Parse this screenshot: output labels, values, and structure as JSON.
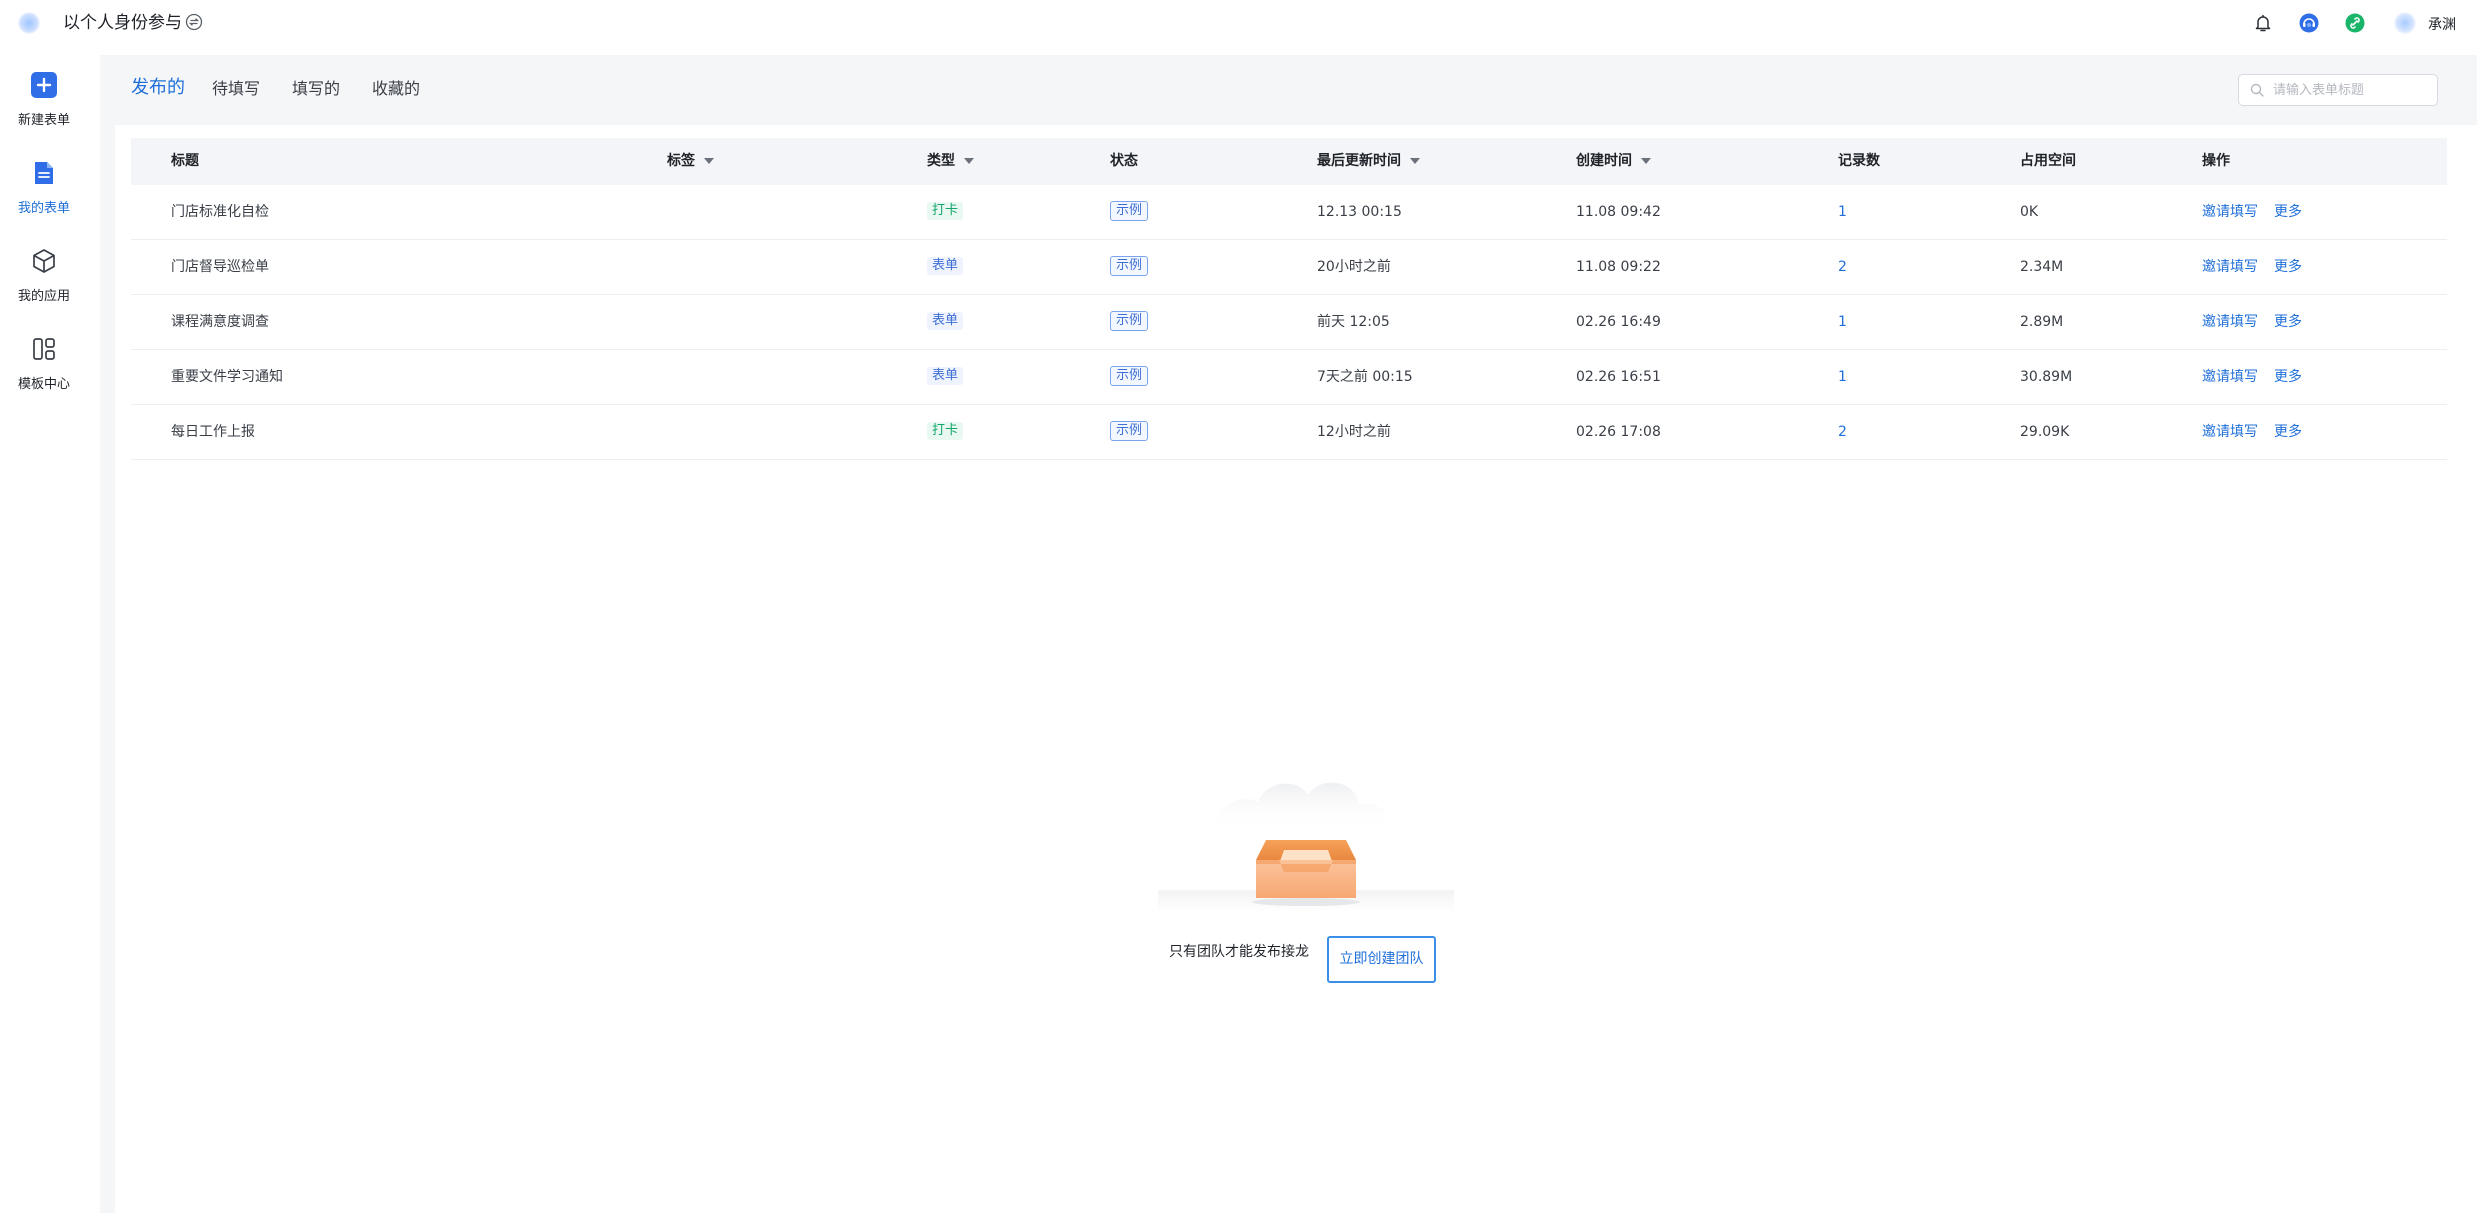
{
  "topbar": {
    "workspace_title": "以个人身份参与",
    "username": "承渊"
  },
  "sidenav": {
    "items": [
      {
        "label": "新建表单",
        "icon": "plus-square-icon"
      },
      {
        "label": "我的表单",
        "icon": "document-icon",
        "active": true
      },
      {
        "label": "我的应用",
        "icon": "cube-icon"
      },
      {
        "label": "模板中心",
        "icon": "layout-icon"
      }
    ]
  },
  "tabs": [
    {
      "label": "发布的",
      "active": true
    },
    {
      "label": "待填写"
    },
    {
      "label": "填写的"
    },
    {
      "label": "收藏的"
    }
  ],
  "search": {
    "placeholder": "请输入表单标题"
  },
  "table": {
    "headers": {
      "title": "标题",
      "tag": "标签",
      "type": "类型",
      "status": "状态",
      "updated": "最后更新时间",
      "created": "创建时间",
      "records": "记录数",
      "storage": "占用空间",
      "actions": "操作"
    },
    "rows": [
      {
        "title": "门店标准化自检",
        "type": "打卡",
        "type_kind": "checkin",
        "status": "示例",
        "updated": "12.13 00:15",
        "created": "11.08 09:42",
        "records": "1",
        "storage": "0K",
        "invite": "邀请填写",
        "more": "更多"
      },
      {
        "title": "门店督导巡检单",
        "type": "表单",
        "type_kind": "form",
        "status": "示例",
        "updated": "20小时之前",
        "created": "11.08 09:22",
        "records": "2",
        "storage": "2.34M",
        "invite": "邀请填写",
        "more": "更多"
      },
      {
        "title": "课程满意度调查",
        "type": "表单",
        "type_kind": "form",
        "status": "示例",
        "updated": "前天 12:05",
        "created": "02.26 16:49",
        "records": "1",
        "storage": "2.89M",
        "invite": "邀请填写",
        "more": "更多"
      },
      {
        "title": "重要文件学习通知",
        "type": "表单",
        "type_kind": "form",
        "status": "示例",
        "updated": "7天之前 00:15",
        "created": "02.26 16:51",
        "records": "1",
        "storage": "30.89M",
        "invite": "邀请填写",
        "more": "更多"
      },
      {
        "title": "每日工作上报",
        "type": "打卡",
        "type_kind": "checkin",
        "status": "示例",
        "updated": "12小时之前",
        "created": "02.26 17:08",
        "records": "2",
        "storage": "29.09K",
        "invite": "邀请填写",
        "more": "更多"
      }
    ]
  },
  "empty_state": {
    "message": "只有团队才能发布接龙",
    "button_label": "立即创建团队"
  },
  "colors": {
    "accent": "#1f6fd9",
    "checkin_tag": "#12a66b",
    "form_tag": "#3f6fd6"
  }
}
